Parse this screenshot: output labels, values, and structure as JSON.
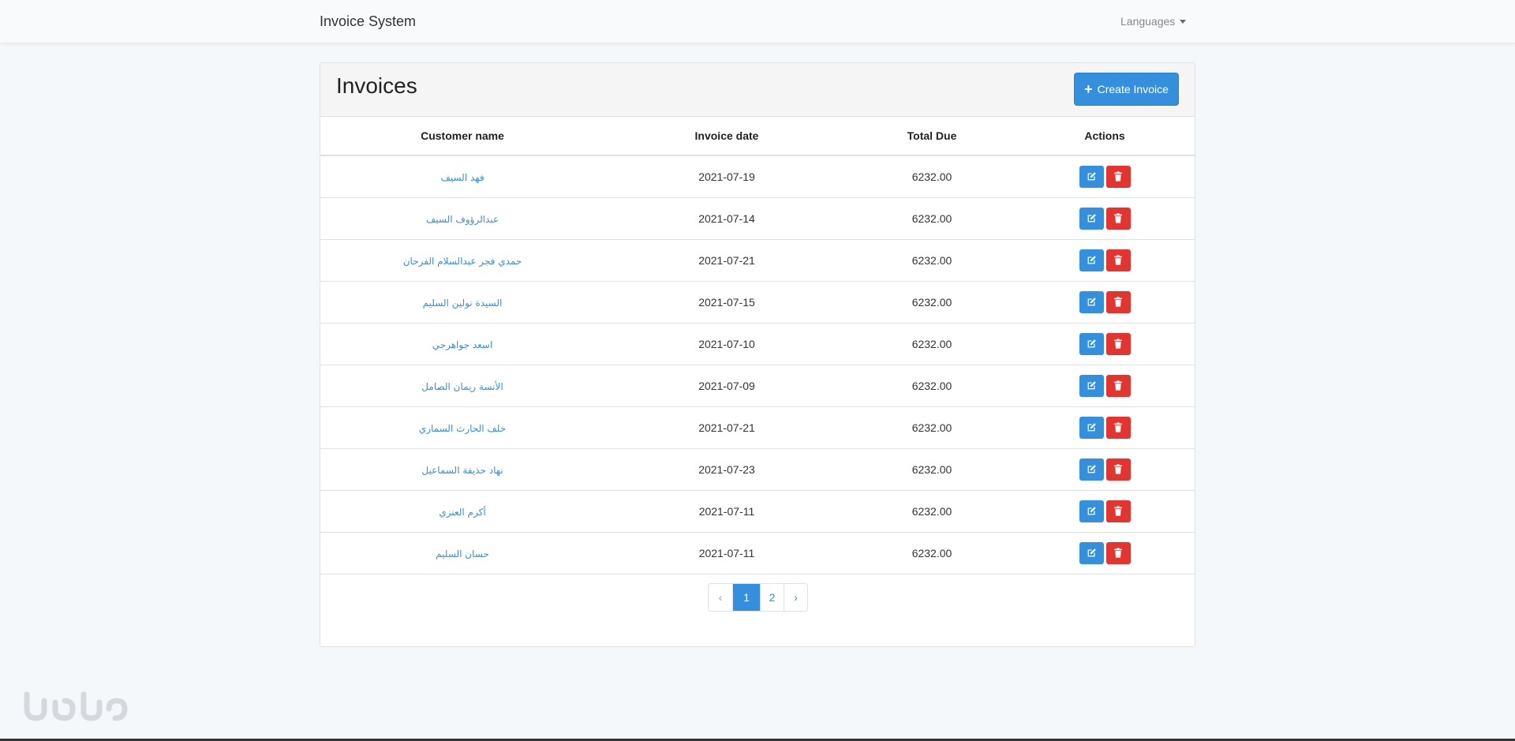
{
  "navbar": {
    "brand": "Invoice System",
    "languages_label": "Languages"
  },
  "card": {
    "title": "Invoices",
    "create_button_label": "Create Invoice"
  },
  "table": {
    "headers": [
      "Customer name",
      "Invoice date",
      "Total Due",
      "Actions"
    ],
    "rows": [
      {
        "name": "فهد السيف",
        "date": "2021-07-19",
        "total": "6232.00"
      },
      {
        "name": "عبدالرؤوف السيف",
        "date": "2021-07-14",
        "total": "6232.00"
      },
      {
        "name": "حمدي فجر عبدالسلام الفرحان",
        "date": "2021-07-21",
        "total": "6232.00"
      },
      {
        "name": "السيدة نولين السليم",
        "date": "2021-07-15",
        "total": "6232.00"
      },
      {
        "name": "اسعد جواهرجي",
        "date": "2021-07-10",
        "total": "6232.00"
      },
      {
        "name": "الأنسة ريمان الصامل",
        "date": "2021-07-09",
        "total": "6232.00"
      },
      {
        "name": "خلف الحارث السماري",
        "date": "2021-07-21",
        "total": "6232.00"
      },
      {
        "name": "نهاد حذيفة السماعيل",
        "date": "2021-07-23",
        "total": "6232.00"
      },
      {
        "name": "أكرم العنزي",
        "date": "2021-07-11",
        "total": "6232.00"
      },
      {
        "name": "حسان السليم",
        "date": "2021-07-11",
        "total": "6232.00"
      }
    ]
  },
  "pagination": {
    "prev": "‹",
    "pages": [
      "1",
      "2"
    ],
    "active": "1",
    "next": "›"
  },
  "colors": {
    "primary": "#3490dc",
    "danger": "#e3342f"
  }
}
